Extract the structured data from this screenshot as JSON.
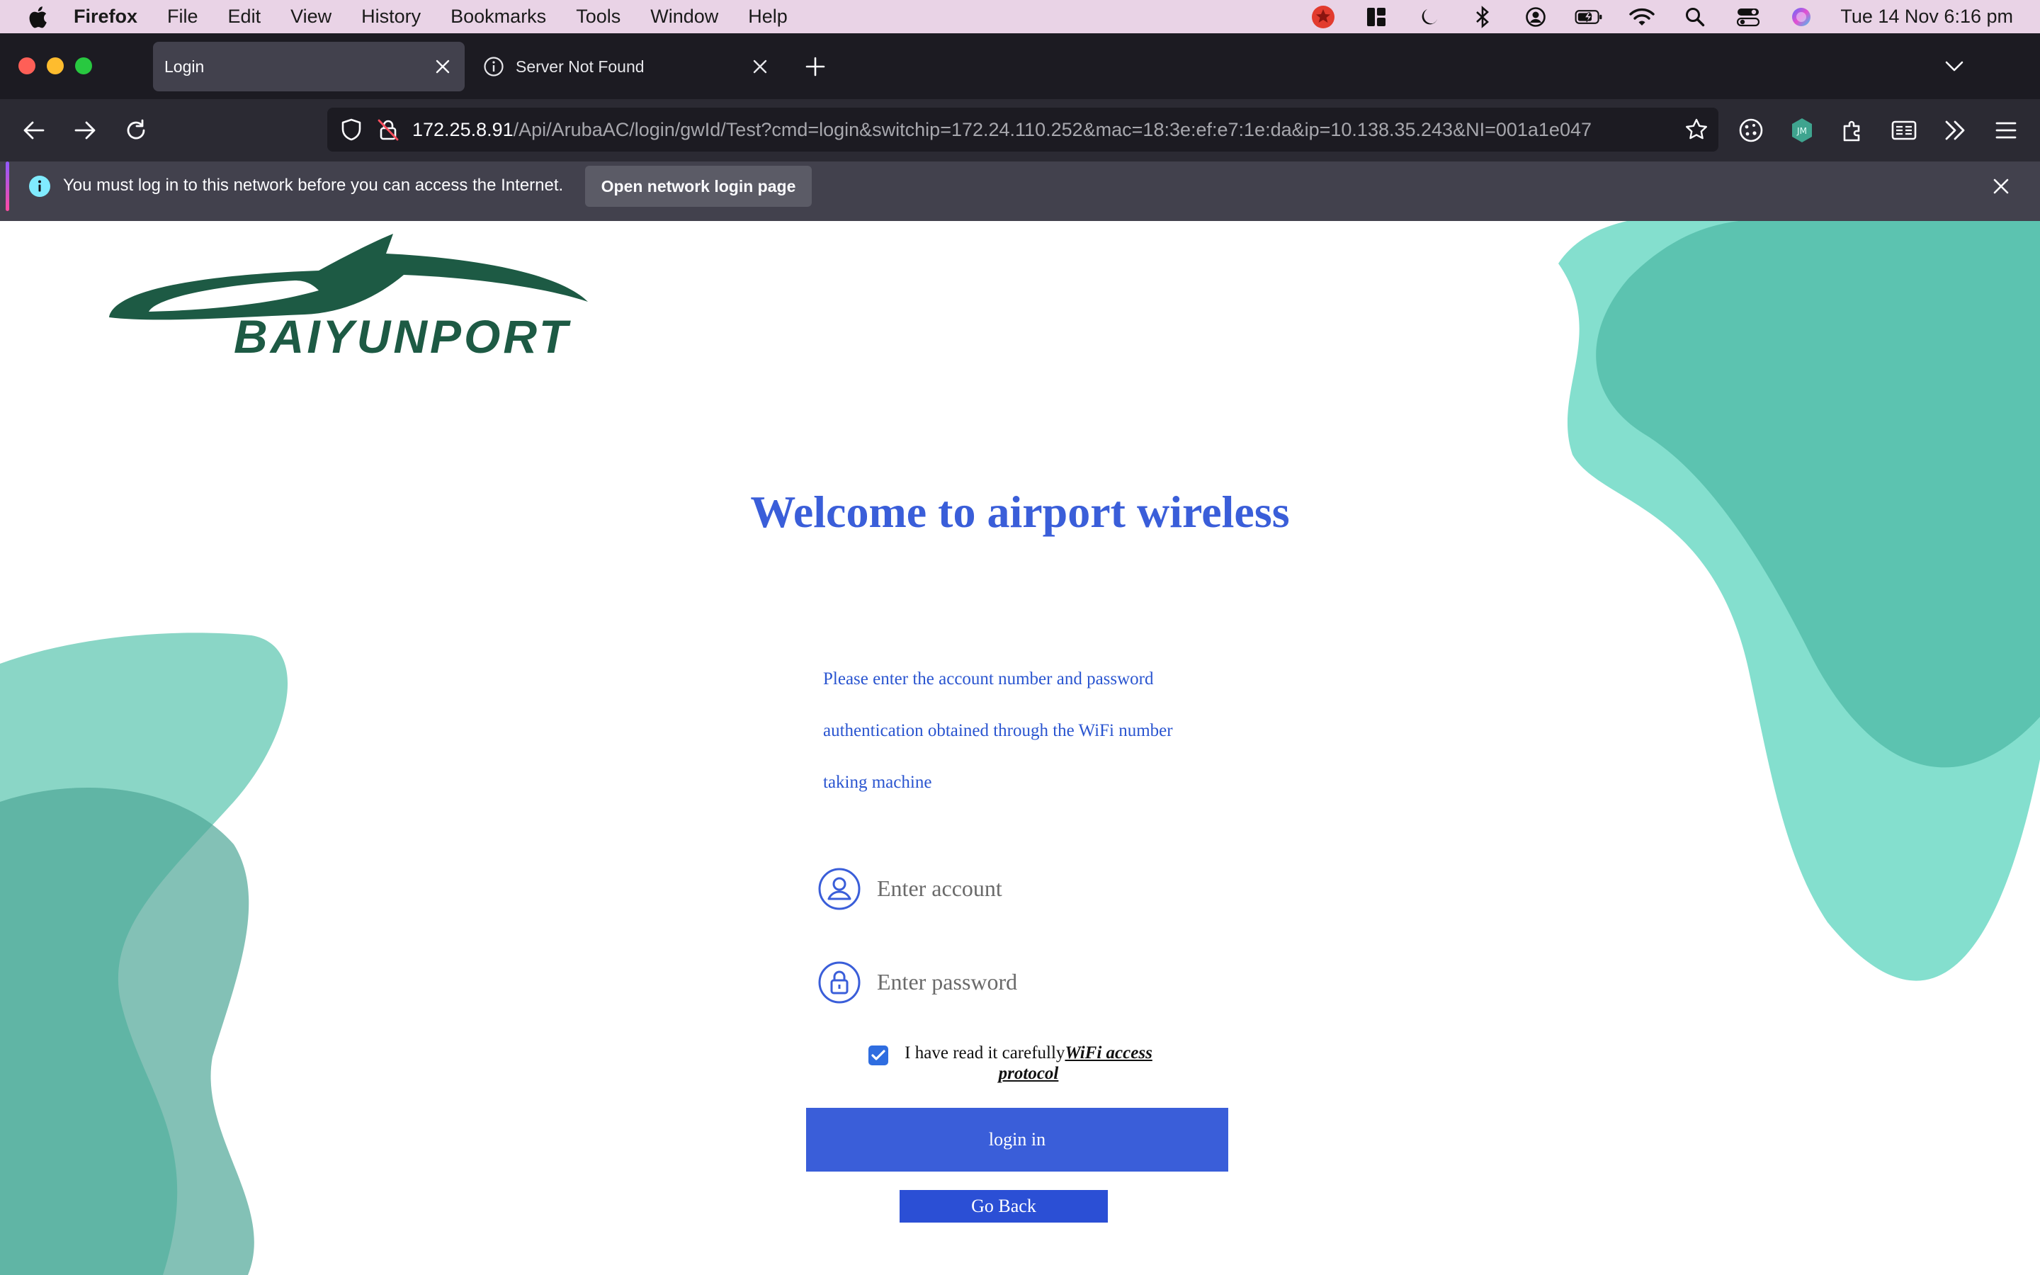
{
  "menubar": {
    "app": "Firefox",
    "items": [
      "File",
      "Edit",
      "View",
      "History",
      "Bookmarks",
      "Tools",
      "Window",
      "Help"
    ],
    "clock": "Tue 14 Nov  6:16 pm",
    "status_icons": [
      "record-icon",
      "layout-icon",
      "moon-icon",
      "bluetooth-icon",
      "user-circle-icon",
      "battery-icon",
      "wifi-icon",
      "search-icon",
      "control-center-icon",
      "siri-icon"
    ]
  },
  "tabs": [
    {
      "label": "Login",
      "active": true
    },
    {
      "label": "Server Not Found",
      "active": false
    }
  ],
  "urlbar": {
    "host": "172.25.8.91",
    "path": "/Api/ArubaAC/login/gwId/Test?cmd=login&switchip=172.24.110.252&mac=18:3e:ef:e7:1e:da&ip=10.138.35.243&NI=001a1e047"
  },
  "notification": {
    "message": "You must log in to this network before you can access the Internet.",
    "button": "Open network login page"
  },
  "page": {
    "logo_text": "BAIYUNPORT",
    "welcome": "Welcome to airport wireless",
    "description": [
      "Please enter the account number and password",
      "authentication obtained through the  WiFi number",
      "taking machine"
    ],
    "account_placeholder": "Enter account",
    "password_placeholder": "Enter password",
    "agree_text": "I have read it carefully",
    "agree_link": "WiFi access protocol",
    "agree_checked": true,
    "login_button": "login in",
    "back_button": "Go Back"
  },
  "colors": {
    "accent_blue": "#3a5ed9",
    "logo_green": "#1d5a44",
    "teal": "#5fcdb7"
  }
}
